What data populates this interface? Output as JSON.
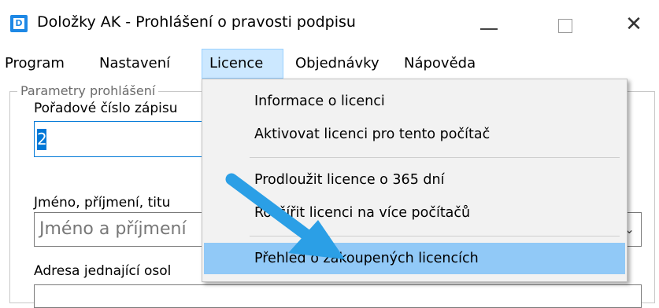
{
  "window": {
    "title": "Doložky AK - Prohlášení o pravosti podpisu",
    "icon_letter": "D",
    "minimize_icon": "minimize-icon",
    "maximize_icon": "maximize-icon",
    "close_glyph": "✕"
  },
  "menubar": {
    "items": [
      {
        "label": "Program"
      },
      {
        "label": "Nastavení"
      },
      {
        "label": "Licence"
      },
      {
        "label": "Objednávky"
      },
      {
        "label": "Nápověda"
      }
    ],
    "active_index": 2
  },
  "form": {
    "group_title": "Parametry prohlášení",
    "order_label": "Pořadové číslo zápisu",
    "order_value": "2",
    "name_label": "Jméno, příjmení, titu",
    "name_placeholder": "Jméno a příjmení",
    "address_label": "Adresa jednající osol"
  },
  "dropdown": {
    "items": [
      {
        "label": "Informace o licenci"
      },
      {
        "label": "Aktivovat licenci pro tento počítač"
      },
      {
        "label": "Prodloužit licence o 365 dní"
      },
      {
        "label": "Rozšířit licenci na více počítačů"
      },
      {
        "label": "Přehled o zakoupených licencích"
      }
    ],
    "highlighted_index": 4
  },
  "annotation": {
    "arrow_color": "#2b9fe6",
    "highlight_color": "#91c9f7",
    "menu_active_color": "#cce8ff"
  }
}
